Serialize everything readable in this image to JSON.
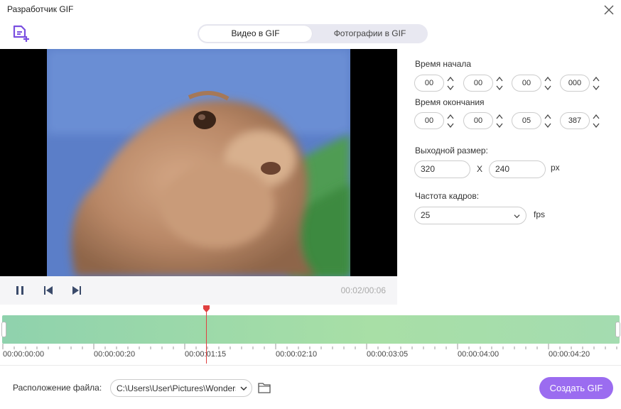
{
  "window": {
    "title": "Разработчик GIF"
  },
  "tabs": [
    {
      "label": "Видео в GIF",
      "active": true
    },
    {
      "label": "Фотографии в GIF",
      "active": false
    }
  ],
  "player": {
    "time": "00:02/00:06"
  },
  "settings": {
    "start_label": "Время начала",
    "start": [
      "00",
      "00",
      "00",
      "000"
    ],
    "end_label": "Время окончания",
    "end": [
      "00",
      "00",
      "05",
      "387"
    ],
    "size_label": "Выходной размер:",
    "width": "320",
    "x_sep": "X",
    "height": "240",
    "size_unit": "px",
    "fps_label": "Частота кадров:",
    "fps": "25",
    "fps_unit": "fps"
  },
  "timeline": {
    "playhead_fraction": 0.33,
    "labels": [
      "00:00:00:00",
      "00:00:00:20",
      "00:00:01:15",
      "00:00:02:10",
      "00:00:03:05",
      "00:00:04:00",
      "00:00:04:20"
    ]
  },
  "footer": {
    "path_label": "Расположение файла:",
    "path": "C:\\Users\\User\\Pictures\\Wondershare",
    "create_label": "Создать GIF"
  },
  "colors": {
    "accent": "#9b6cf0",
    "track": "#a8dfa6",
    "playhead": "#e04040"
  },
  "icons": [
    "close-icon",
    "add-file-icon",
    "pause-icon",
    "prev-frame-icon",
    "next-frame-icon",
    "chevron-down-icon",
    "folder-icon"
  ]
}
